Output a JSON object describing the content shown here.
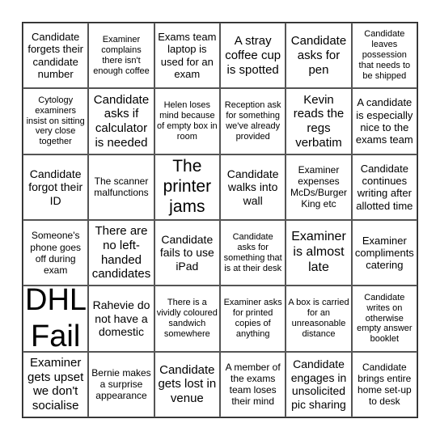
{
  "cells": [
    "Candidate forgets their candidate number",
    "Examiner complains there isn't enough coffee",
    "Exams team laptop is used for an exam",
    "A stray coffee cup is spotted",
    "Candidate asks for pen",
    "Candidate leaves possession that needs to be shipped",
    "Cytology examiners insist on sitting very close together",
    "Candidate asks if calculator is needed",
    "Helen loses mind because of empty box in room",
    "Reception ask for something we've already provided",
    "Kevin reads the regs verbatim",
    "A candidate is especially nice to the exams team",
    "Candidate forgot their ID",
    "The scanner malfunctions",
    "The printer jams",
    "Candidate walks into wall",
    "Examiner expenses McDs/Burger King etc",
    "Candidate continues writing after allotted time",
    "Someone's phone goes off during exam",
    "There are no left-handed candidates",
    "Candidate fails to use iPad",
    "Candidate asks for something that is at their desk",
    "Examiner is almost late",
    "Examiner compliments catering",
    "DHL Fail",
    "Rahevie do not have a domestic",
    "There is a vividly coloured sandwich somewhere",
    "Examiner asks for printed copies of anything",
    "A box is carried for an unreasonable distance",
    "Candidate writes on otherwise empty answer booklet",
    "Examiner gets upset we don't socialise",
    "Bernie makes a surprise appearance",
    "Candidate gets lost in venue",
    "A member of the exams team loses their mind",
    "Candidate engages in unsolicited pic sharing",
    "Candidate brings entire home set-up to desk"
  ]
}
